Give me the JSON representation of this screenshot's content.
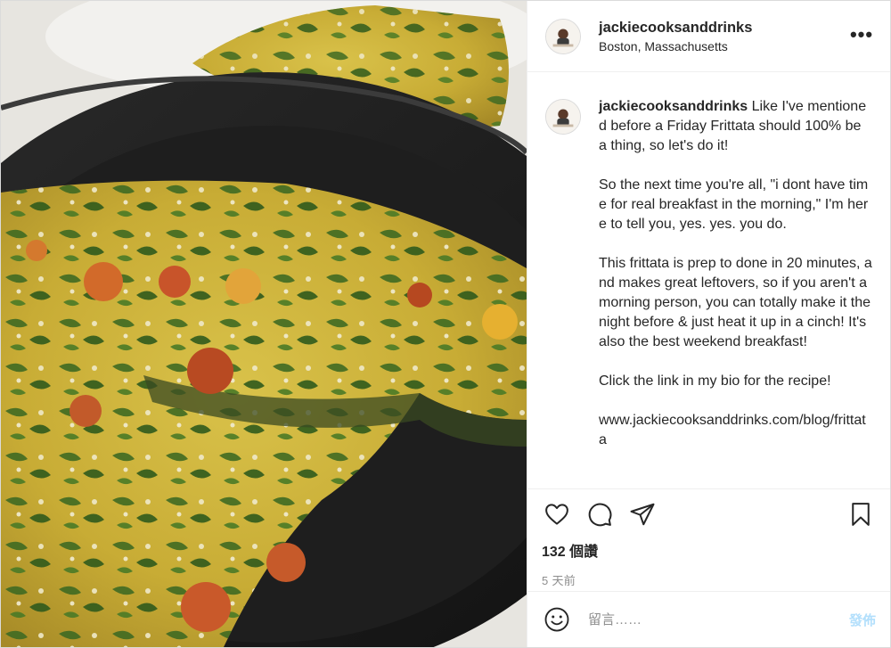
{
  "post": {
    "username": "jackiecooksanddrinks",
    "location": "Boston, Massachusetts",
    "more_label": "•••",
    "caption_user": "jackiecooksanddrinks",
    "caption_text": " Like I've mentioned before a Friday Frittata should 100% be a thing, so let's do it!\n\nSo the next time you're all, \"i dont have time for real breakfast in the morning,\" I'm here to tell you, yes. yes. you do.\n\nThis frittata is prep to done in 20 minutes, and makes great leftovers, so if you aren't a morning person, you can totally make it the night before & just heat it up in a cinch! It's also the best weekend breakfast!\n\nClick the link in my bio for the recipe!\n\nwww.jackiecooksanddrinks.com/blog/frittata",
    "likes": "132 個讚",
    "time_ago": "5 天前"
  },
  "icons": {
    "like": "heart-icon",
    "comment": "comment-icon",
    "share": "paper-plane-icon",
    "save": "bookmark-icon",
    "emoji": "emoji-icon",
    "more": "ellipsis-icon"
  },
  "comment_box": {
    "placeholder": "留言……",
    "post_label": "發佈"
  },
  "colors": {
    "text": "#262626",
    "muted": "#8e8e8e",
    "border": "#efefef",
    "post_button_disabled": "#b2dffc"
  }
}
